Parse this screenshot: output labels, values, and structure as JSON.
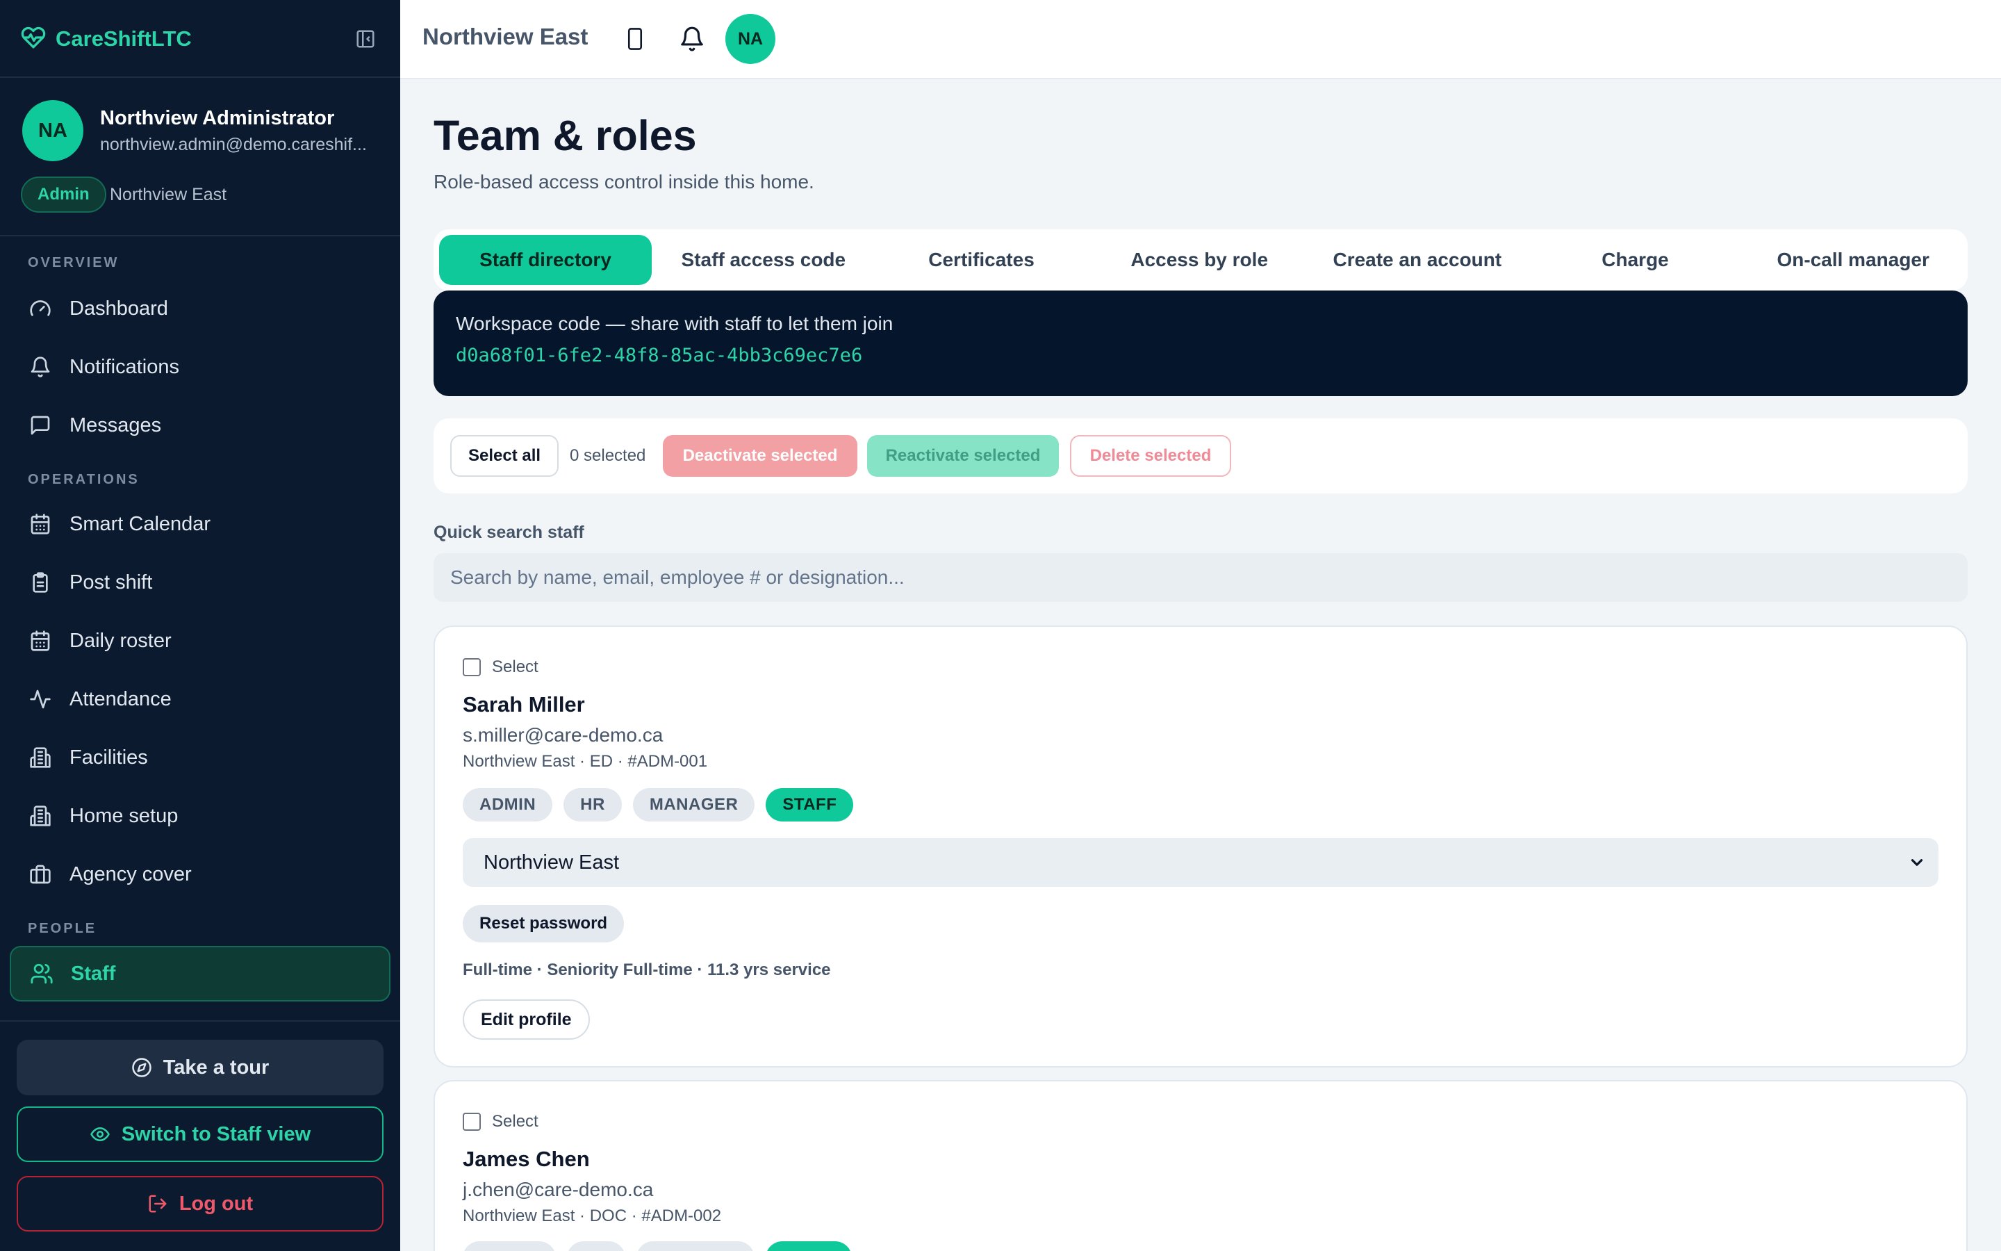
{
  "app": {
    "name": "CareShiftLTC"
  },
  "user": {
    "initials": "NA",
    "name": "Northview Administrator",
    "email": "northview.admin@demo.careshif...",
    "role": "Admin",
    "home": "Northview East"
  },
  "nav": {
    "sections": [
      {
        "label": "OVERVIEW",
        "items": [
          {
            "label": "Dashboard",
            "icon": "gauge-icon"
          },
          {
            "label": "Notifications",
            "icon": "bell-icon"
          },
          {
            "label": "Messages",
            "icon": "message-icon"
          }
        ]
      },
      {
        "label": "OPERATIONS",
        "items": [
          {
            "label": "Smart Calendar",
            "icon": "calendar-icon"
          },
          {
            "label": "Post shift",
            "icon": "clipboard-icon"
          },
          {
            "label": "Daily roster",
            "icon": "calendar-icon"
          },
          {
            "label": "Attendance",
            "icon": "activity-icon"
          },
          {
            "label": "Facilities",
            "icon": "building-icon"
          },
          {
            "label": "Home setup",
            "icon": "building-icon"
          },
          {
            "label": "Agency cover",
            "icon": "briefcase-icon"
          }
        ]
      },
      {
        "label": "PEOPLE",
        "items": [
          {
            "label": "Staff",
            "icon": "users-icon",
            "active": true
          }
        ]
      }
    ],
    "tour": "Take a tour",
    "switch_view": "Switch to Staff view",
    "logout": "Log out"
  },
  "topbar": {
    "title": "Northview East",
    "initials": "NA"
  },
  "page": {
    "title": "Team & roles",
    "subtitle": "Role-based access control inside this home."
  },
  "tabs": [
    {
      "label": "Staff directory",
      "active": true
    },
    {
      "label": "Staff access code"
    },
    {
      "label": "Certificates"
    },
    {
      "label": "Access by role"
    },
    {
      "label": "Create an account"
    },
    {
      "label": "Charge"
    },
    {
      "label": "On-call manager"
    }
  ],
  "workspace": {
    "title": "Workspace code — share with staff to let them join",
    "code": "d0a68f01-6fe2-48f8-85ac-4bb3c69ec7e6"
  },
  "bulk": {
    "select_all": "Select all",
    "count": "0 selected",
    "deactivate": "Deactivate selected",
    "reactivate": "Reactivate selected",
    "delete": "Delete selected"
  },
  "search": {
    "label": "Quick search staff",
    "placeholder": "Search by name, email, employee # or designation..."
  },
  "staff": [
    {
      "select_label": "Select",
      "name": "Sarah Miller",
      "email": "s.miller@care-demo.ca",
      "meta": "Northview East · ED · #ADM-001",
      "roles": [
        "ADMIN",
        "HR",
        "MANAGER",
        "STAFF"
      ],
      "active_role": "STAFF",
      "home": "Northview East",
      "reset": "Reset password",
      "employment": "Full-time · Seniority Full-time · 11.3 yrs service",
      "edit": "Edit profile"
    },
    {
      "select_label": "Select",
      "name": "James Chen",
      "email": "j.chen@care-demo.ca",
      "meta": "Northview East · DOC · #ADM-002"
    }
  ],
  "colors": {
    "accent": "#10c99a",
    "sidebar": "#0b1a2e",
    "danger": "#f0596c"
  }
}
